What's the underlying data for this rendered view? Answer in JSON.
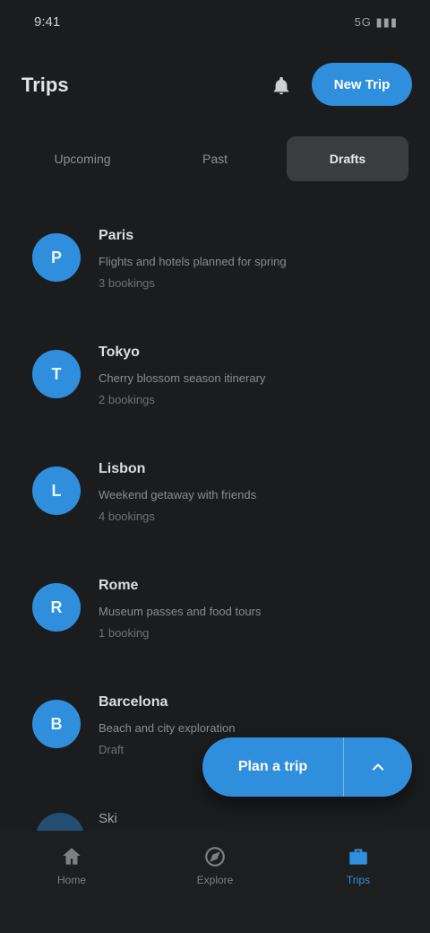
{
  "status": {
    "time": "9:41",
    "indicators": "5G ▮▮▮"
  },
  "appbar": {
    "title": "Trips",
    "action_label": "New Trip"
  },
  "tabs": [
    {
      "label": "Upcoming"
    },
    {
      "label": "Past"
    },
    {
      "label": "Drafts"
    }
  ],
  "items": [
    {
      "initial": "P",
      "title": "Paris",
      "line1": "Flights and hotels planned for spring",
      "line2": "3 bookings"
    },
    {
      "initial": "T",
      "title": "Tokyo",
      "line1": "Cherry blossom season itinerary",
      "line2": "2 bookings"
    },
    {
      "initial": "L",
      "title": "Lisbon",
      "line1": "Weekend getaway with friends",
      "line2": "4 bookings"
    },
    {
      "initial": "R",
      "title": "Rome",
      "line1": "Museum passes and food tours",
      "line2": "1 booking"
    },
    {
      "initial": "B",
      "title": "Barcelona",
      "line1": "Beach and city exploration",
      "line2": "Draft"
    }
  ],
  "partial_item": {
    "title": "Ski"
  },
  "fab": {
    "label": "Plan a trip"
  },
  "nav": [
    {
      "label": "Home",
      "icon": "home-icon"
    },
    {
      "label": "Explore",
      "icon": "compass-icon"
    },
    {
      "label": "Trips",
      "icon": "briefcase-icon"
    }
  ],
  "colors": {
    "accent": "#2f8fdc",
    "background": "#1b1c1e",
    "tab_active": "#3a3c40"
  }
}
